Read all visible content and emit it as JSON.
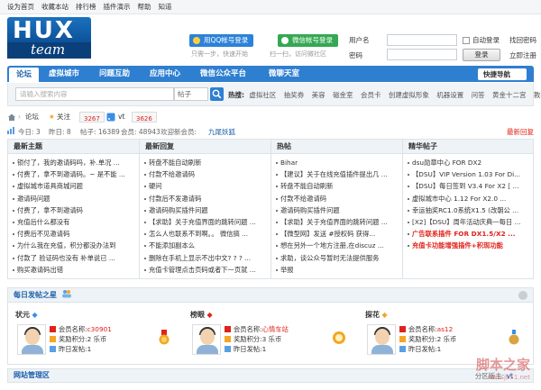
{
  "topbar": [
    "设为首页",
    "收藏本站",
    "排行榜",
    "插件演示",
    "帮助",
    "知道"
  ],
  "logo": {
    "main": "HUX",
    "sub": "team"
  },
  "login": {
    "qq_button": "用QQ帐号登录",
    "qq_hint": "只需一步，快速开始",
    "wechat_button": "微信帐号登录",
    "wechat_hint": "扫一扫，访问微社区",
    "username_label": "用户名",
    "password_label": "密码",
    "auto_login": "自动登录",
    "find_password": "找回密码",
    "register": "立即注册",
    "login_button": "登录"
  },
  "nav": {
    "items": [
      "论坛",
      "虚拟城市",
      "问题互助",
      "应用中心",
      "微信公众平台",
      "微聊天室"
    ],
    "quick": "快捷导航"
  },
  "search": {
    "placeholder": "请输入搜索内容",
    "type": "帖子",
    "hot_label": "热搜:",
    "hot": [
      "虚拟社区",
      "抽奖券",
      "美容",
      "磁金室",
      "会员卡",
      "创建虚拟形象",
      "机器设置",
      "问答",
      "黄金十二宫",
      "教程",
      "特色"
    ]
  },
  "crumb": {
    "home": "论坛",
    "follow": "关注",
    "follow_count": "3267",
    "vt": "vt",
    "vt_count": "3626"
  },
  "stats": {
    "today": "今日: 3",
    "yesterday": "昨日: 8",
    "posts": "帖子: 16389",
    "members": "会员: 48943",
    "welcome": "欢迎新会员:",
    "new_member": "九尾妖狐",
    "latest": "最新回复"
  },
  "columns": [
    {
      "title": "最新主题",
      "items": [
        "锁付了，我的邀请码吗，补.单况 ...",
        "付费了，拿不到邀请码。~ 是不能 ...",
        "虚拟城市道具商城问题",
        "邀请码问题",
        "付费了，拿不到邀请码",
        "充值后什么都没有",
        "付费后不见邀请码",
        "为什么我在充值，积分都没办法到",
        "付款了 验证码也没有 补单说已 ...",
        "购买邀请码出错"
      ],
      "red": []
    },
    {
      "title": "最新回复",
      "items": [
        "转盘不能自动刷新",
        "付款不给邀请码",
        "硬问",
        "付款后不发邀请码",
        "邀请码购买插件问题",
        "【求助】关于充值界面的跳转问题 ...",
        "怎么人也联系不到啊。。 微信搞 ...",
        "不能添加副本么",
        "删除在手机上显示不出中文? ? ? ...",
        "充值卡管理点击页码或者下一页就 ..."
      ],
      "red": []
    },
    {
      "title": "热帖",
      "items": [
        "Bihar",
        "【建议】关于在线充值插件提出几 ...",
        "转盘不能自动刷新",
        "付款不给邀请码",
        "邀请码购买插件问题",
        "【求助】关于充值界面的跳转问题 ...",
        "【微型网】发送 #授权码 获得...",
        "想在另外一个地方注册,在discuz ...",
        "求助，谈公众号暂时无法提供服务",
        "举报"
      ],
      "red": []
    },
    {
      "title": "精华帖子",
      "items": [
        "dsu勋章中心 FOR DX2",
        "【DSU】VIP Version 1.03 For Di...",
        "【DSU】每日签到 V3.4 For X2 [ ...",
        "虚拟城市中心 1.12 For X2.0 ...",
        "幸运抽奖RC1.0系统X1.5 (改朝公 ...",
        "[X2]【DSU】周年活动庆典一每日 ...",
        "广告联系插件 FOR DX1.5/X2 ...",
        "充值卡功能增强插件+积现功能"
      ],
      "red": [
        6,
        7
      ]
    }
  ],
  "stars": {
    "title": "每日发帖之星",
    "cards": [
      {
        "rank": "状元",
        "member_label": "会员名称:",
        "member": "c30901",
        "credits": "奖励积分:2 乐币",
        "yesterday": "昨日发帖:1"
      },
      {
        "rank": "榜眼",
        "member_label": "会员名称:",
        "member": "心情车站",
        "credits": "奖励积分:3 乐币",
        "yesterday": "昨日发帖:1"
      },
      {
        "rank": "探花",
        "member_label": "会员名称:",
        "member": "as12",
        "credits": "奖励积分:2 乐币",
        "yesterday": "昨日发帖:1"
      }
    ]
  },
  "manage": {
    "title": "网站管理区",
    "moderator_label": "分区版主:",
    "moderator": "vt"
  },
  "watermark": {
    "main": "脚本之家",
    "sub": "www.jb51.net"
  },
  "colors": {
    "brand_blue": "#2f7fd0",
    "red": "#e0221a",
    "qq_blue": "#2c82d8",
    "wechat_green": "#34a853"
  }
}
